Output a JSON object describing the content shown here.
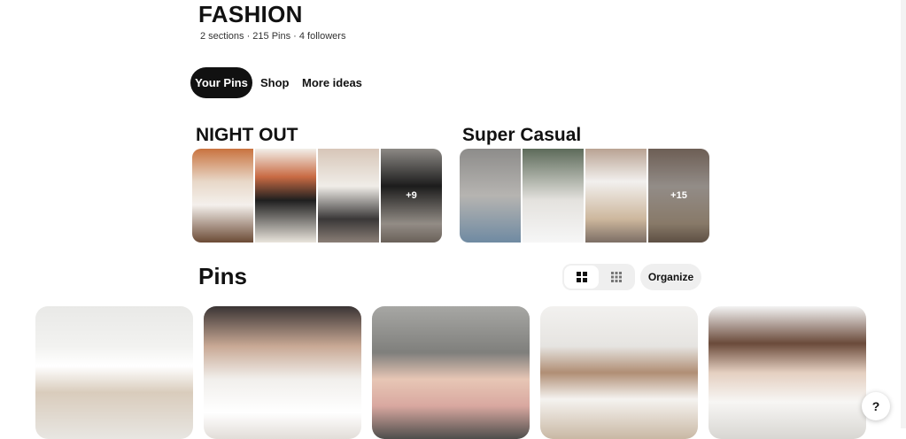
{
  "board": {
    "title": "FASHION",
    "meta": "2 sections · 215 Pins · 4 followers"
  },
  "tabs": [
    {
      "label": "Your Pins",
      "active": true
    },
    {
      "label": "Shop",
      "active": false
    },
    {
      "label": "More ideas",
      "active": false
    }
  ],
  "sections": [
    {
      "title": "NIGHT OUT",
      "more_count": "+9"
    },
    {
      "title": "Super Casual",
      "more_count": "+15"
    }
  ],
  "pins_section": {
    "heading": "Pins",
    "organize_label": "Organize",
    "layout_icons": [
      "default-grid-icon",
      "compact-grid-icon"
    ]
  },
  "help": {
    "label": "?"
  },
  "colors": {
    "active_tab_bg": "#111111",
    "button_bg": "#efefef"
  }
}
